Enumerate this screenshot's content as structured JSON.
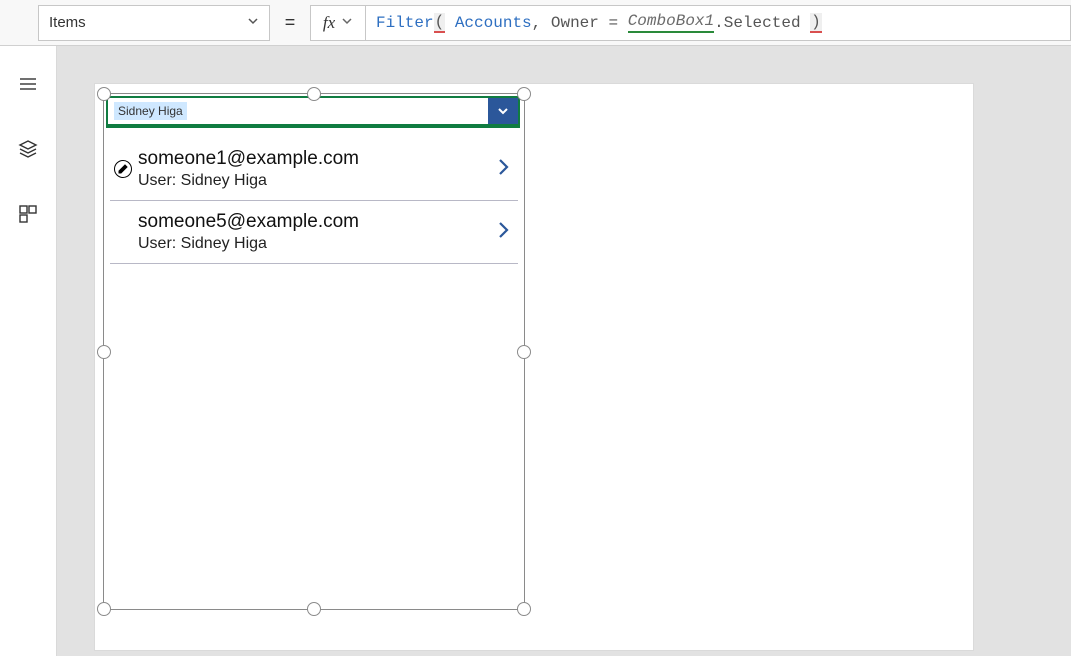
{
  "property_dropdown": {
    "selected": "Items"
  },
  "equals": "=",
  "fx_label": "fx",
  "formula": {
    "fn": "Filter",
    "lparen": "(",
    "arg1": "Accounts",
    "comma": ",",
    "field": "Owner",
    "eq": "=",
    "ref": "ComboBox1",
    "dotSelected": ".Selected",
    "rparen": ")"
  },
  "rail": {
    "tree_icon": "tree-view-icon",
    "insert_icon": "insert-icon",
    "components_icon": "components-icon"
  },
  "combobox": {
    "selected_tag": "Sidney Higa"
  },
  "gallery_items": [
    {
      "title": "someone1@example.com",
      "subtitle": "User: Sidney Higa"
    },
    {
      "title": "someone5@example.com",
      "subtitle": "User: Sidney Higa"
    }
  ]
}
